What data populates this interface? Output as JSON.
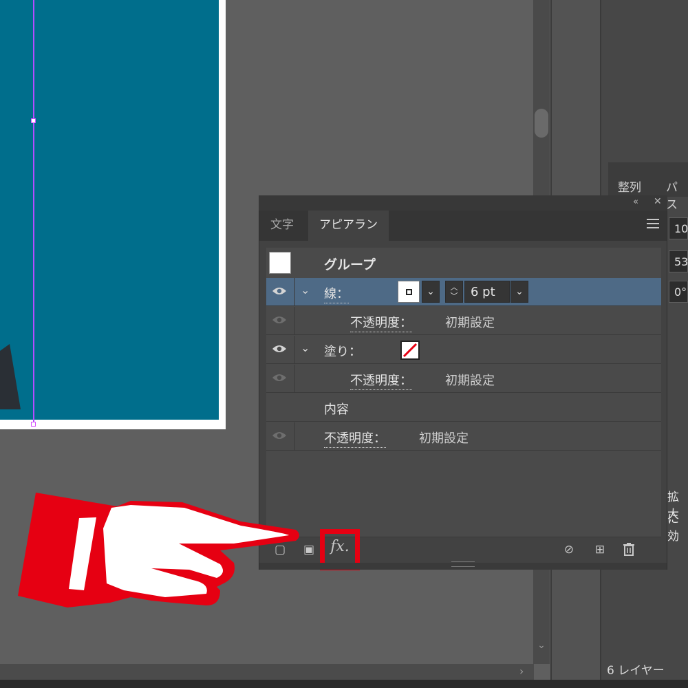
{
  "panel": {
    "tabs": [
      "文字",
      "アピアランス"
    ],
    "active_tab": "アピアランス",
    "object_type": "グループ",
    "stroke": {
      "label": "線：",
      "weight": "6 pt",
      "opacity_label": "不透明度：",
      "opacity_value": "初期設定"
    },
    "fill": {
      "label": "塗り：",
      "opacity_label": "不透明度：",
      "opacity_value": "初期設定"
    },
    "contents_label": "内容",
    "opacity": {
      "label": "不透明度：",
      "value": "初期設定"
    },
    "fx_label": "fx.",
    "icons": {
      "collapse": "double-chevron-left-icon",
      "close": "close-icon",
      "menu": "hamburger-menu-icon",
      "visibility": "eye-icon",
      "clear": "prohibited-icon",
      "duplicate": "plus-square-icon",
      "delete": "trash-icon"
    }
  },
  "background_panel": {
    "tabs": [
      "整列",
      "パス"
    ],
    "field_values": [
      "10",
      "53",
      "0°"
    ],
    "text_fragments": [
      "拡大",
      "に効"
    ],
    "layer_count": "6 レイヤー"
  },
  "annotation": {
    "highlight_color": "#e60012",
    "hand_color": "#e60012"
  },
  "artboard": {
    "fill_color": "#006e8c"
  }
}
